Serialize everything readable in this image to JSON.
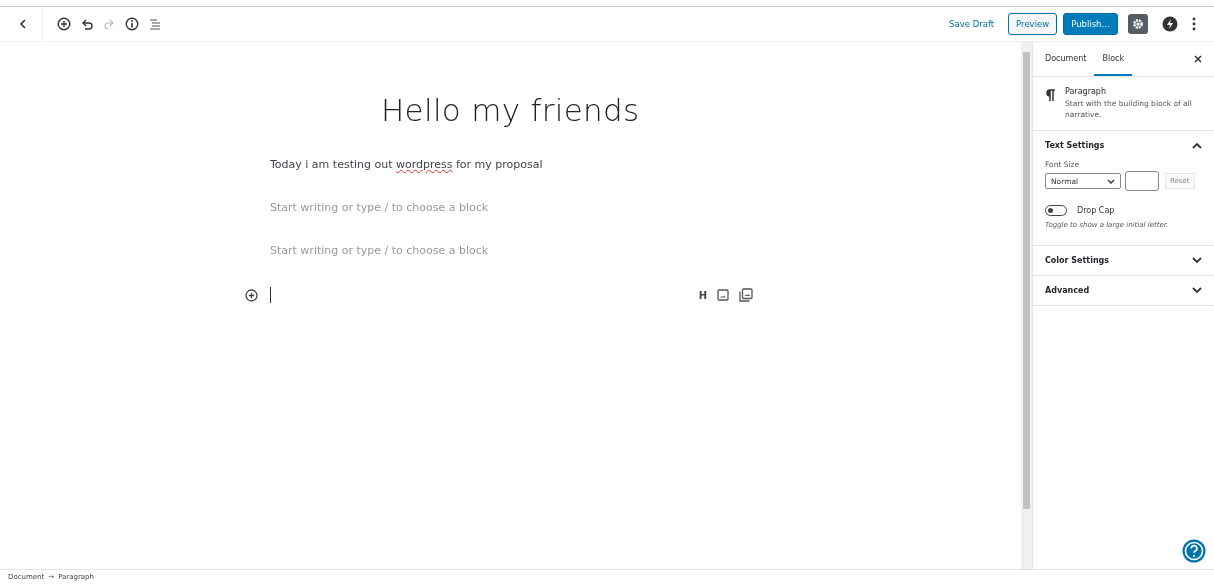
{
  "toolbar": {
    "save_draft": "Save Draft",
    "preview": "Preview",
    "publish": "Publish…",
    "settings_active": true,
    "redo_disabled": true
  },
  "editor": {
    "title": "Hello my friends",
    "blocks": [
      {
        "kind": "text",
        "segments": [
          {
            "text": "Today i am testing out ",
            "misspelled": false
          },
          {
            "text": "wordpress",
            "misspelled": true
          },
          {
            "text": " for my proposal",
            "misspelled": false
          }
        ]
      },
      {
        "kind": "empty",
        "placeholder": "Start writing or type / to choose a block"
      },
      {
        "kind": "empty",
        "placeholder": "Start writing or type / to choose a block"
      },
      {
        "kind": "caret"
      }
    ],
    "quick_inserters": [
      "H"
    ]
  },
  "sidebar": {
    "tabs": [
      {
        "label": "Document",
        "selected": false
      },
      {
        "label": "Block",
        "selected": true
      }
    ],
    "block_card": {
      "name": "Paragraph",
      "description": "Start with the building block of all narrative."
    },
    "panels": [
      {
        "title": "Text Settings",
        "expanded": true,
        "font_size_label": "Font Size",
        "font_size": "Normal",
        "reset": "Reset",
        "drop_cap": {
          "label": "Drop Cap",
          "on": false,
          "help": "Toggle to show a large initial letter."
        }
      },
      {
        "title": "Color Settings",
        "expanded": false
      },
      {
        "title": "Advanced",
        "expanded": false
      }
    ]
  },
  "breadcrumb": [
    "Document",
    "→",
    "Paragraph"
  ]
}
